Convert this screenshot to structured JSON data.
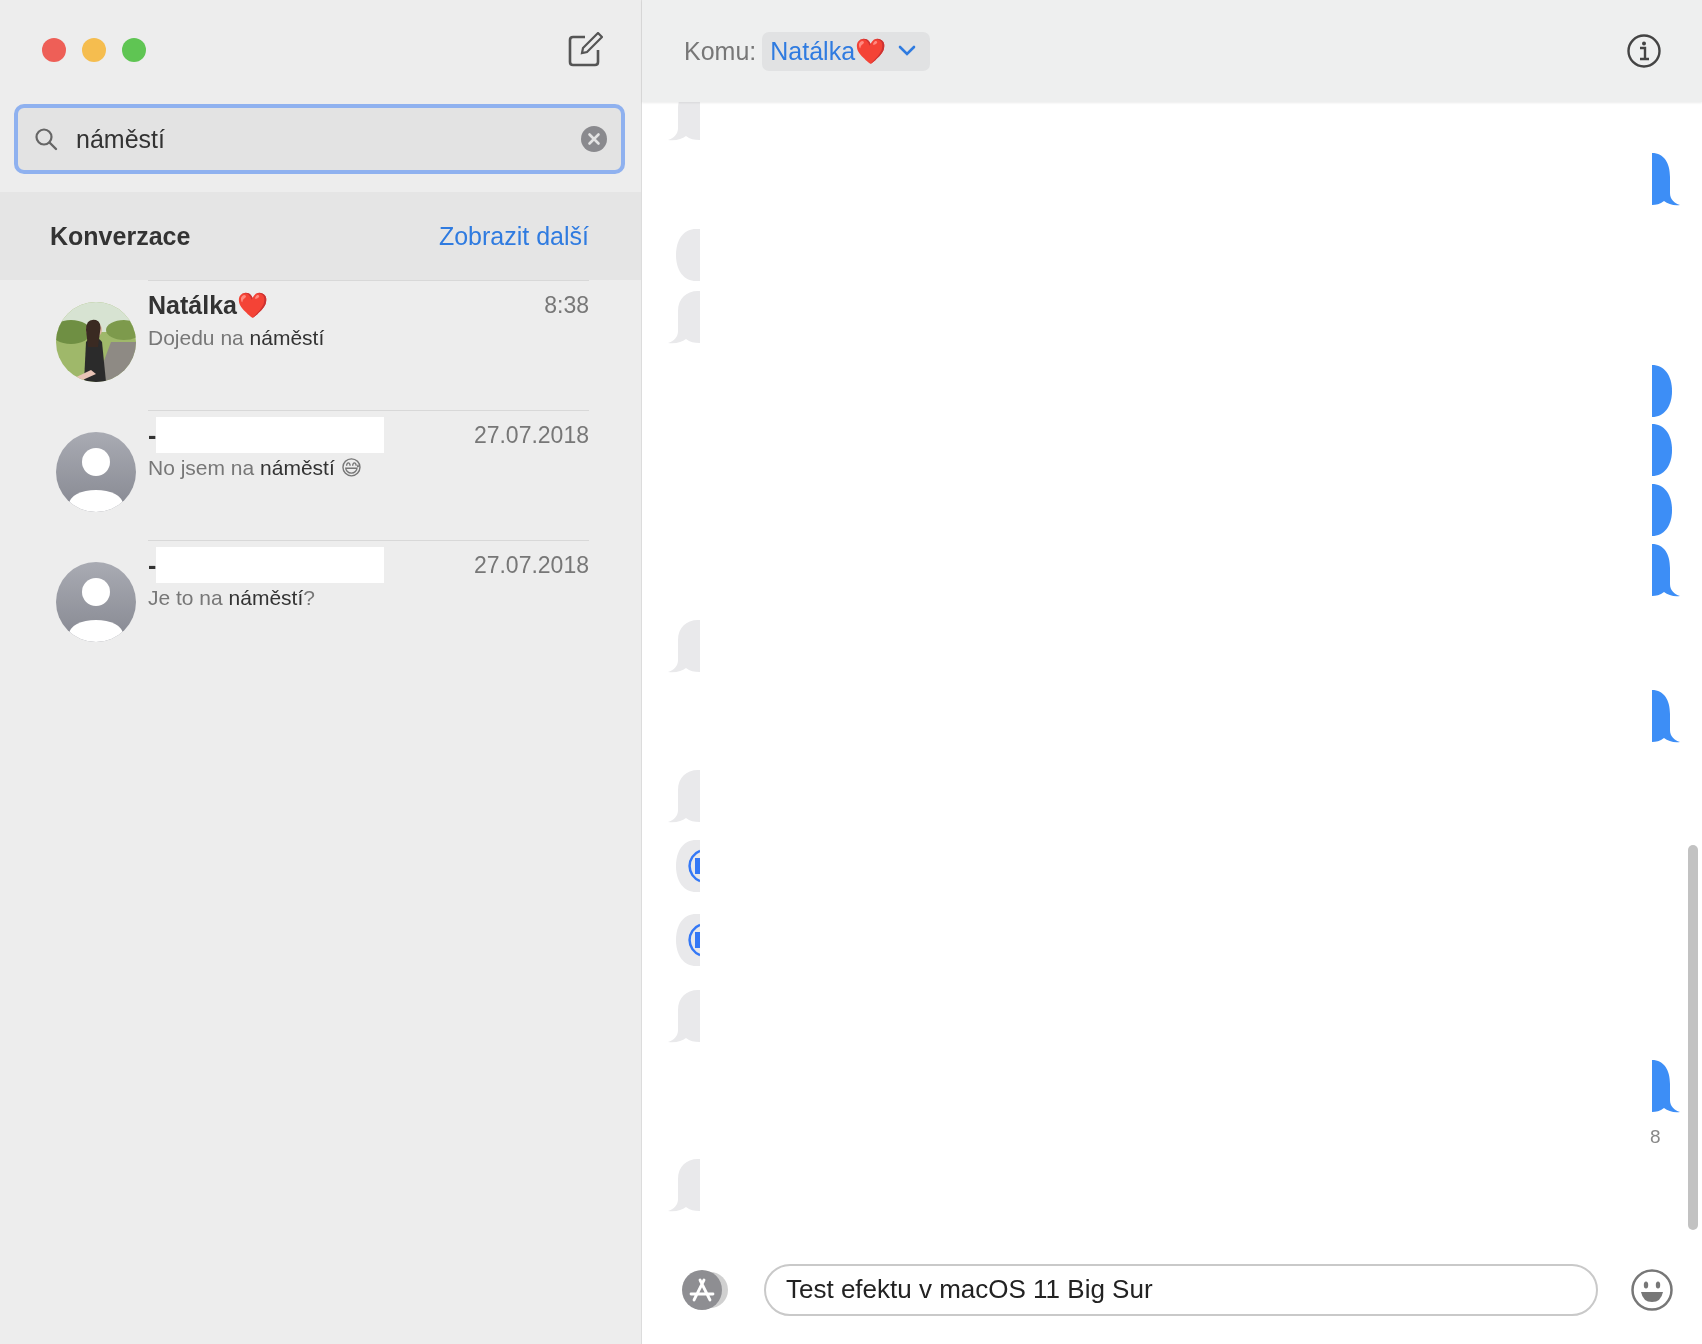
{
  "window": {
    "controls": [
      {
        "color": "#ee5f57"
      },
      {
        "color": "#f5bd4f"
      },
      {
        "color": "#5fc553"
      }
    ]
  },
  "sidebar": {
    "search": {
      "value": "náměstí"
    },
    "section": {
      "title": "Konverzace",
      "link": "Zobrazit další"
    },
    "conversations": [
      {
        "name": "Natálka❤️",
        "time": "8:38",
        "preview": "Dojedu na **náměstí**",
        "has_photo": true,
        "redacted": false
      },
      {
        "name": "-",
        "time": "27.07.2018",
        "preview": "No jsem na **náměstí** 😅",
        "has_photo": false,
        "redacted": true
      },
      {
        "name": "-",
        "time": "27.07.2018",
        "preview": "Je to na **náměstí**?",
        "has_photo": false,
        "redacted": true
      }
    ]
  },
  "conversation": {
    "to_label": "Komu:",
    "recipient": "Natálka❤️",
    "incoming_bubbles": [
      {
        "kind": "tail"
      },
      {
        "kind": "plain"
      },
      {
        "kind": "tail"
      },
      {
        "kind": "tail"
      },
      {
        "kind": "tail"
      },
      {
        "kind": "audio"
      },
      {
        "kind": "audio"
      },
      {
        "kind": "tail"
      },
      {
        "kind": "tail"
      }
    ],
    "outgoing_bubbles": [
      {
        "kind": "tail"
      },
      {
        "kind": "plain"
      },
      {
        "kind": "plain"
      },
      {
        "kind": "plain"
      },
      {
        "kind": "tail"
      },
      {
        "kind": "tail"
      },
      {
        "kind": "tail"
      }
    ],
    "timestamp": "8",
    "composer": {
      "value": "Test efektu v macOS 11 Big Sur"
    }
  }
}
